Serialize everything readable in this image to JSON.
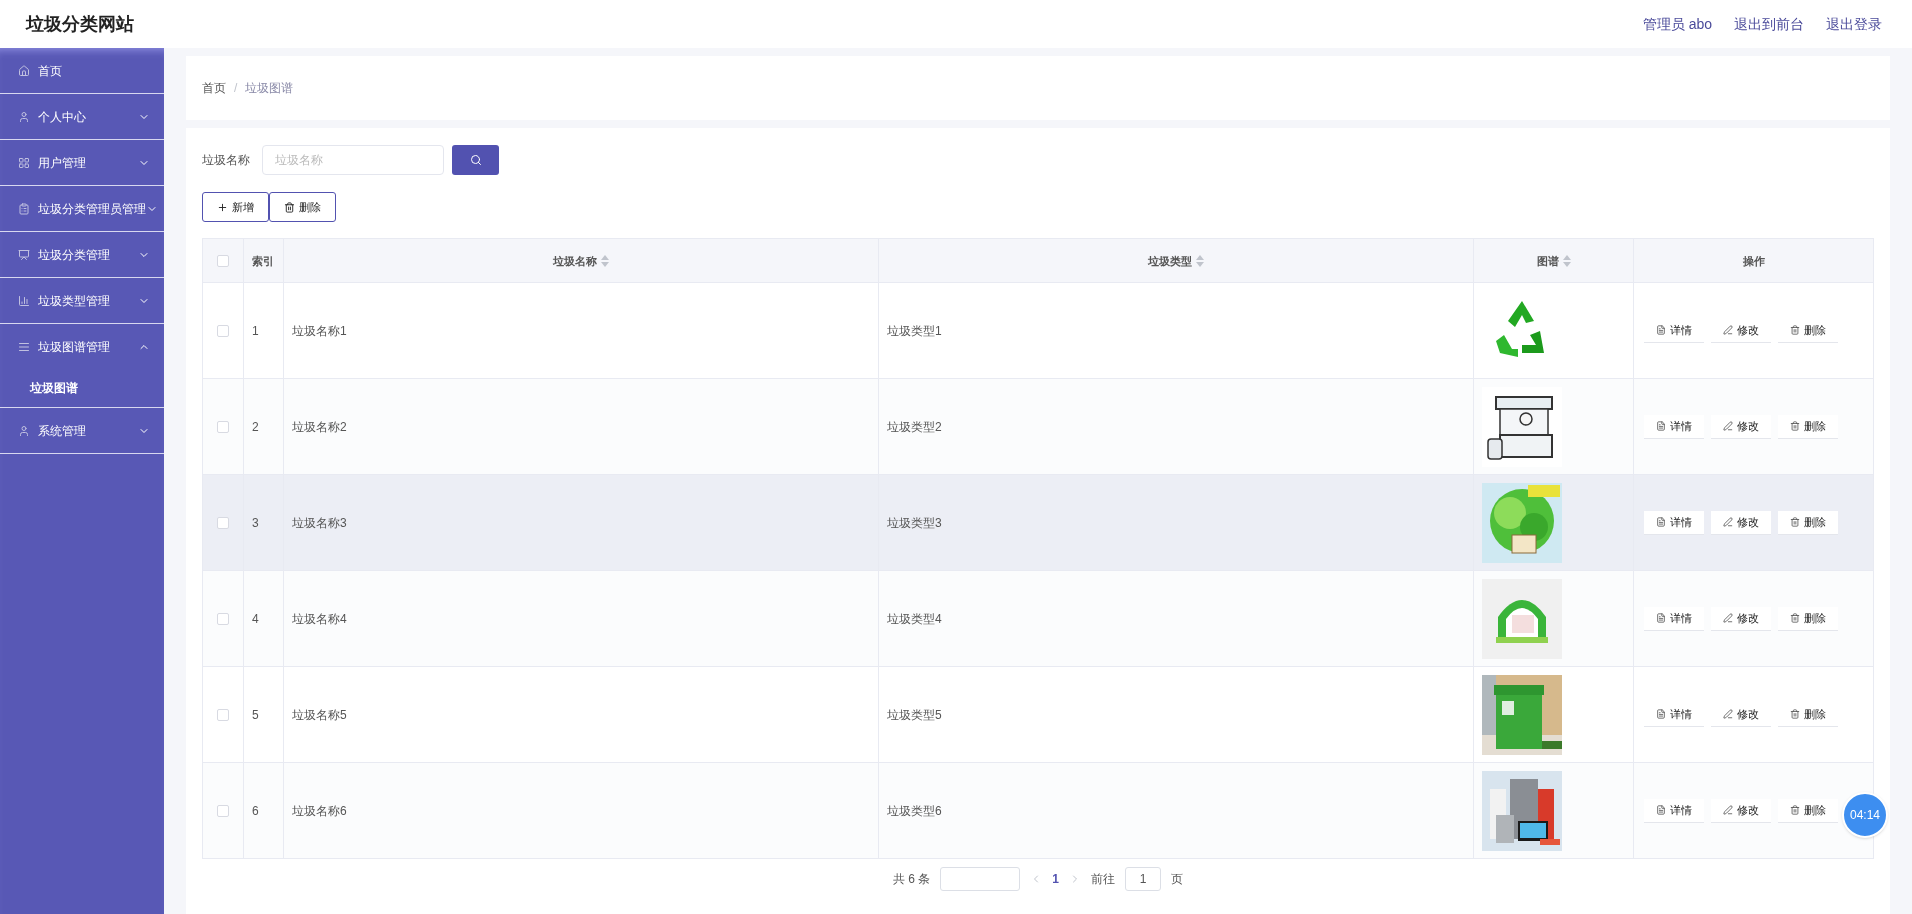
{
  "site_title": "垃圾分类网站",
  "header_links": [
    "管理员 abo",
    "退出到前台",
    "退出登录"
  ],
  "sidebar": {
    "items": [
      {
        "label": "首页"
      },
      {
        "label": "个人中心",
        "expanded": false
      },
      {
        "label": "用户管理",
        "expanded": false
      },
      {
        "label": "垃圾分类管理员管理",
        "expanded": false
      },
      {
        "label": "垃圾分类管理",
        "expanded": false
      },
      {
        "label": "垃圾类型管理",
        "expanded": false
      },
      {
        "label": "垃圾图谱管理",
        "expanded": true,
        "children": [
          {
            "label": "垃圾图谱",
            "selected": true
          }
        ]
      },
      {
        "label": "系统管理",
        "expanded": false
      }
    ]
  },
  "breadcrumb": {
    "items": [
      "首页",
      "垃圾图谱"
    ],
    "separator": "/"
  },
  "search": {
    "label": "垃圾名称",
    "placeholder": "垃圾名称"
  },
  "toolbar": [
    {
      "kind": "add",
      "label": "新增"
    },
    {
      "kind": "delete",
      "label": "删除"
    }
  ],
  "table": {
    "columns": [
      {
        "label": "索引",
        "sortable": false
      },
      {
        "label": "垃圾名称",
        "sortable": true
      },
      {
        "label": "垃圾类型",
        "sortable": true
      },
      {
        "label": "图谱",
        "sortable": true
      },
      {
        "label": "操作",
        "sortable": false
      }
    ],
    "all_checked": false,
    "rows": [
      {
        "checked": false,
        "highlighted": false,
        "index": "1",
        "name": "垃圾名称1",
        "type": "垃圾类型1",
        "actions": [
          "详情",
          "修改",
          "删除"
        ]
      },
      {
        "checked": false,
        "highlighted": false,
        "index": "2",
        "name": "垃圾名称2",
        "type": "垃圾类型2",
        "actions": [
          "详情",
          "修改",
          "删除"
        ]
      },
      {
        "checked": false,
        "highlighted": true,
        "index": "3",
        "name": "垃圾名称3",
        "type": "垃圾类型3",
        "actions": [
          "详情",
          "修改",
          "删除"
        ]
      },
      {
        "checked": false,
        "highlighted": false,
        "index": "4",
        "name": "垃圾名称4",
        "type": "垃圾类型4",
        "actions": [
          "详情",
          "修改",
          "删除"
        ]
      },
      {
        "checked": false,
        "highlighted": false,
        "index": "5",
        "name": "垃圾名称5",
        "type": "垃圾类型5",
        "actions": [
          "详情",
          "修改",
          "删除"
        ]
      },
      {
        "checked": false,
        "highlighted": false,
        "index": "6",
        "name": "垃圾名称6",
        "type": "垃圾类型6",
        "actions": [
          "详情",
          "修改",
          "删除"
        ]
      }
    ]
  },
  "pagination": {
    "total": "共 6 条",
    "current_page": "1",
    "goto": "前往",
    "goto_value": "1",
    "unit": "页"
  },
  "timer": "04:14"
}
